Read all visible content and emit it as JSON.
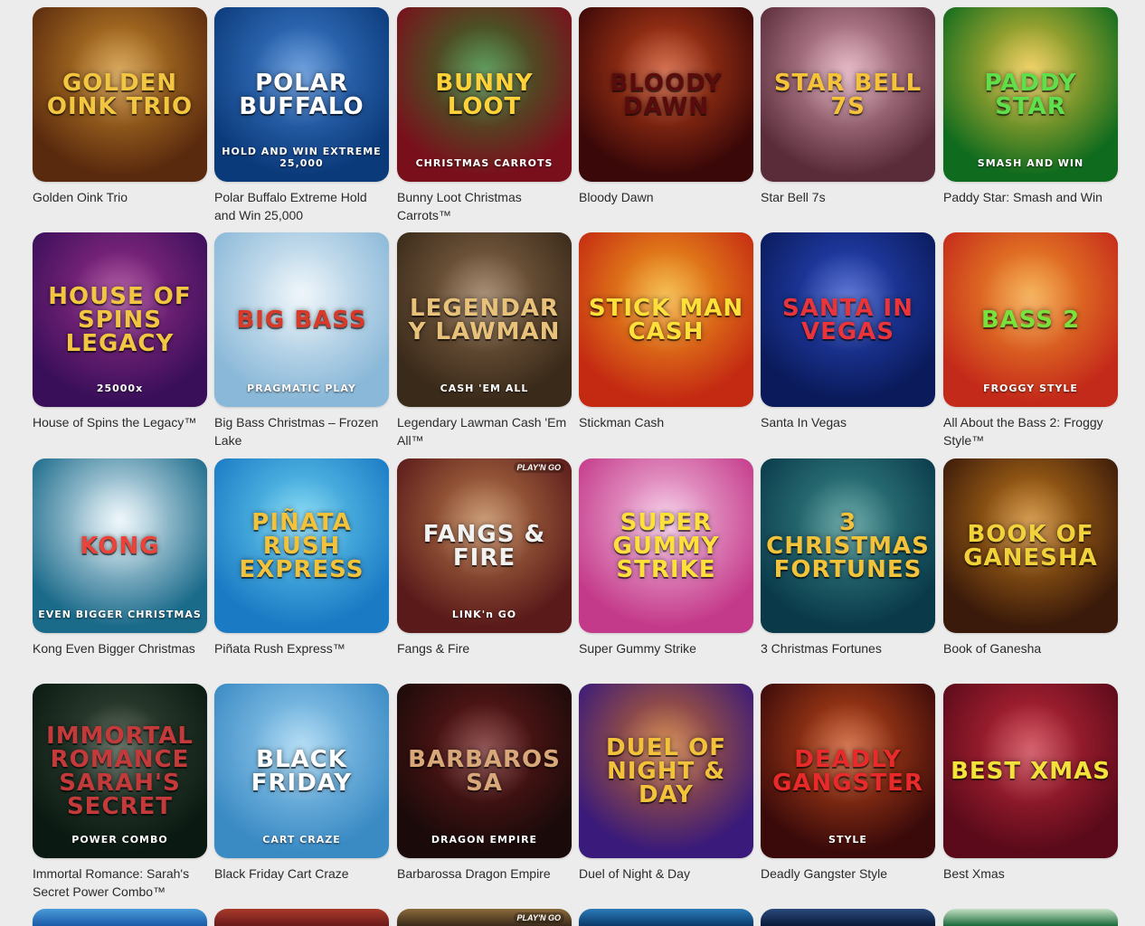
{
  "games": [
    {
      "title": "Golden Oink Trio",
      "art_title": "GOLDEN OINK TRIO",
      "art_sub": "",
      "badge": "",
      "bg1": "#5a2a0e",
      "bg2": "#c98a2a",
      "fg": "#f2c640"
    },
    {
      "title": "Polar Buffalo Extreme Hold and Win 25,000",
      "art_title": "POLAR BUFFALO",
      "art_sub": "HOLD AND WIN EXTREME 25,000",
      "badge": "",
      "bg1": "#0b3a7a",
      "bg2": "#3f7fcf",
      "fg": "#ffffff"
    },
    {
      "title": "Bunny Loot Christmas Carrots™",
      "art_title": "BUNNY LOOT",
      "art_sub": "CHRISTMAS CARROTS",
      "badge": "",
      "bg1": "#7a0f1c",
      "bg2": "#2f7a2a",
      "fg": "#ffd23a"
    },
    {
      "title": "Bloody Dawn",
      "art_title": "BLOODY DAWN",
      "art_sub": "",
      "badge": "",
      "bg1": "#3a0808",
      "bg2": "#c4431a",
      "fg": "#5a0c0c"
    },
    {
      "title": "Star Bell 7s",
      "art_title": "STAR BELL 7s",
      "art_sub": "",
      "badge": "",
      "bg1": "#5a2c3a",
      "bg2": "#d9a0b0",
      "fg": "#f5c23a"
    },
    {
      "title": "Paddy Star: Smash and Win",
      "art_title": "PADDY STAR",
      "art_sub": "SMASH AND WIN",
      "badge": "",
      "bg1": "#0f6b1e",
      "bg2": "#e8c23a",
      "fg": "#5fe04a"
    },
    {
      "title": "House of Spins the Legacy™",
      "art_title": "HOUSE OF SPINS LEGACY",
      "art_sub": "25000x",
      "badge": "",
      "bg1": "#3a0f5a",
      "bg2": "#9a2f8a",
      "fg": "#f2c640"
    },
    {
      "title": "Big Bass Christmas – Frozen Lake",
      "art_title": "BIG BASS",
      "art_sub": "PRAGMATIC PLAY",
      "badge": "",
      "bg1": "#8ab8d8",
      "bg2": "#e8f2f8",
      "fg": "#d83a2a"
    },
    {
      "title": "Legendary Lawman Cash 'Em All™",
      "art_title": "LEGENDARY LAWMAN",
      "art_sub": "CASH 'EM ALL",
      "badge": "",
      "bg1": "#3a2a1a",
      "bg2": "#8a6a4a",
      "fg": "#e8c27a"
    },
    {
      "title": "Stickman Cash",
      "art_title": "STICK MAN CASH",
      "art_sub": "",
      "badge": "",
      "bg1": "#c42a12",
      "bg2": "#f2a81e",
      "fg": "#ffe03a"
    },
    {
      "title": "Santa In Vegas",
      "art_title": "SANTA IN VEGAS",
      "art_sub": "",
      "badge": "",
      "bg1": "#0a1a5a",
      "bg2": "#2a4ac4",
      "fg": "#e8343a"
    },
    {
      "title": "All About the Bass 2: Froggy Style™",
      "art_title": "BASS 2",
      "art_sub": "FROGGY STYLE",
      "badge": "",
      "bg1": "#c42a1a",
      "bg2": "#f29a2a",
      "fg": "#7ae03a"
    },
    {
      "title": "Kong Even Bigger Christmas",
      "art_title": "KONG",
      "art_sub": "EVEN BIGGER CHRISTMAS",
      "badge": "",
      "bg1": "#1a6a8a",
      "bg2": "#e8f4fa",
      "fg": "#e8443a"
    },
    {
      "title": "Piñata Rush Express™",
      "art_title": "PIÑATA RUSH EXPRESS",
      "art_sub": "",
      "badge": "",
      "bg1": "#1a7ac4",
      "bg2": "#6ad0f0",
      "fg": "#f2c23a"
    },
    {
      "title": "Fangs & Fire",
      "art_title": "FANGS & FIRE",
      "art_sub": "LINK'n GO",
      "badge": "PLAY'N GO",
      "bg1": "#5a1a1a",
      "bg2": "#b87a4a",
      "fg": "#f2f2f2"
    },
    {
      "title": "Super Gummy Strike",
      "art_title": "SUPER GUMMY STRIKE",
      "art_sub": "",
      "badge": "",
      "bg1": "#c43a8a",
      "bg2": "#f2c0e0",
      "fg": "#ffe03a"
    },
    {
      "title": "3 Christmas Fortunes",
      "art_title": "3 CHRISTMAS FORTUNES",
      "art_sub": "",
      "badge": "",
      "bg1": "#0a3a4a",
      "bg2": "#3a8a8a",
      "fg": "#f2c23a"
    },
    {
      "title": "Book of Ganesha",
      "art_title": "BOOK OF GANESHA",
      "art_sub": "",
      "badge": "",
      "bg1": "#3a1a0a",
      "bg2": "#c47a1a",
      "fg": "#f2d23a"
    },
    {
      "title": "Immortal Romance: Sarah's Secret Power Combo™",
      "art_title": "IMMORTAL ROMANCE SARAH'S SECRET",
      "art_sub": "POWER COMBO",
      "badge": "",
      "bg1": "#0a1a12",
      "bg2": "#3a4a3a",
      "fg": "#c43a3a"
    },
    {
      "title": "Black Friday Cart Craze",
      "art_title": "BLACK FRIDAY",
      "art_sub": "CART CRAZE",
      "badge": "",
      "bg1": "#3a8ac4",
      "bg2": "#9ad0f0",
      "fg": "#ffffff"
    },
    {
      "title": "Barbarossa Dragon Empire",
      "art_title": "BARBAROSSA",
      "art_sub": "DRAGON EMPIRE",
      "badge": "",
      "bg1": "#1a0a0a",
      "bg2": "#6a1a1a",
      "fg": "#d8a87a"
    },
    {
      "title": "Duel of Night & Day",
      "art_title": "DUEL OF NIGHT & DAY",
      "art_sub": "",
      "badge": "",
      "bg1": "#3a1a7a",
      "bg2": "#c46a2a",
      "fg": "#f2c23a"
    },
    {
      "title": "Deadly Gangster Style",
      "art_title": "DEADLY GANGSTER",
      "art_sub": "STYLE",
      "badge": "",
      "bg1": "#3a0a0a",
      "bg2": "#c44a1a",
      "fg": "#e82a2a"
    },
    {
      "title": "Best Xmas",
      "art_title": "BEST XMAS",
      "art_sub": "",
      "badge": "",
      "bg1": "#5a0a1a",
      "bg2": "#c42a3a",
      "fg": "#f2e23a"
    }
  ],
  "partial_row": [
    {
      "bg1": "#1a5aa8",
      "bg2": "#4a9ad8",
      "badge": ""
    },
    {
      "bg1": "#6a1a1a",
      "bg2": "#a83a2a",
      "badge": ""
    },
    {
      "bg1": "#3a2a1a",
      "bg2": "#8a6a3a",
      "badge": "PLAY'N GO"
    },
    {
      "bg1": "#0a3a6a",
      "bg2": "#2a7ab8",
      "badge": ""
    },
    {
      "bg1": "#0a1a3a",
      "bg2": "#2a4a7a",
      "badge": ""
    },
    {
      "bg1": "#1a6a3a",
      "bg2": "#c4e0c4",
      "badge": ""
    }
  ]
}
